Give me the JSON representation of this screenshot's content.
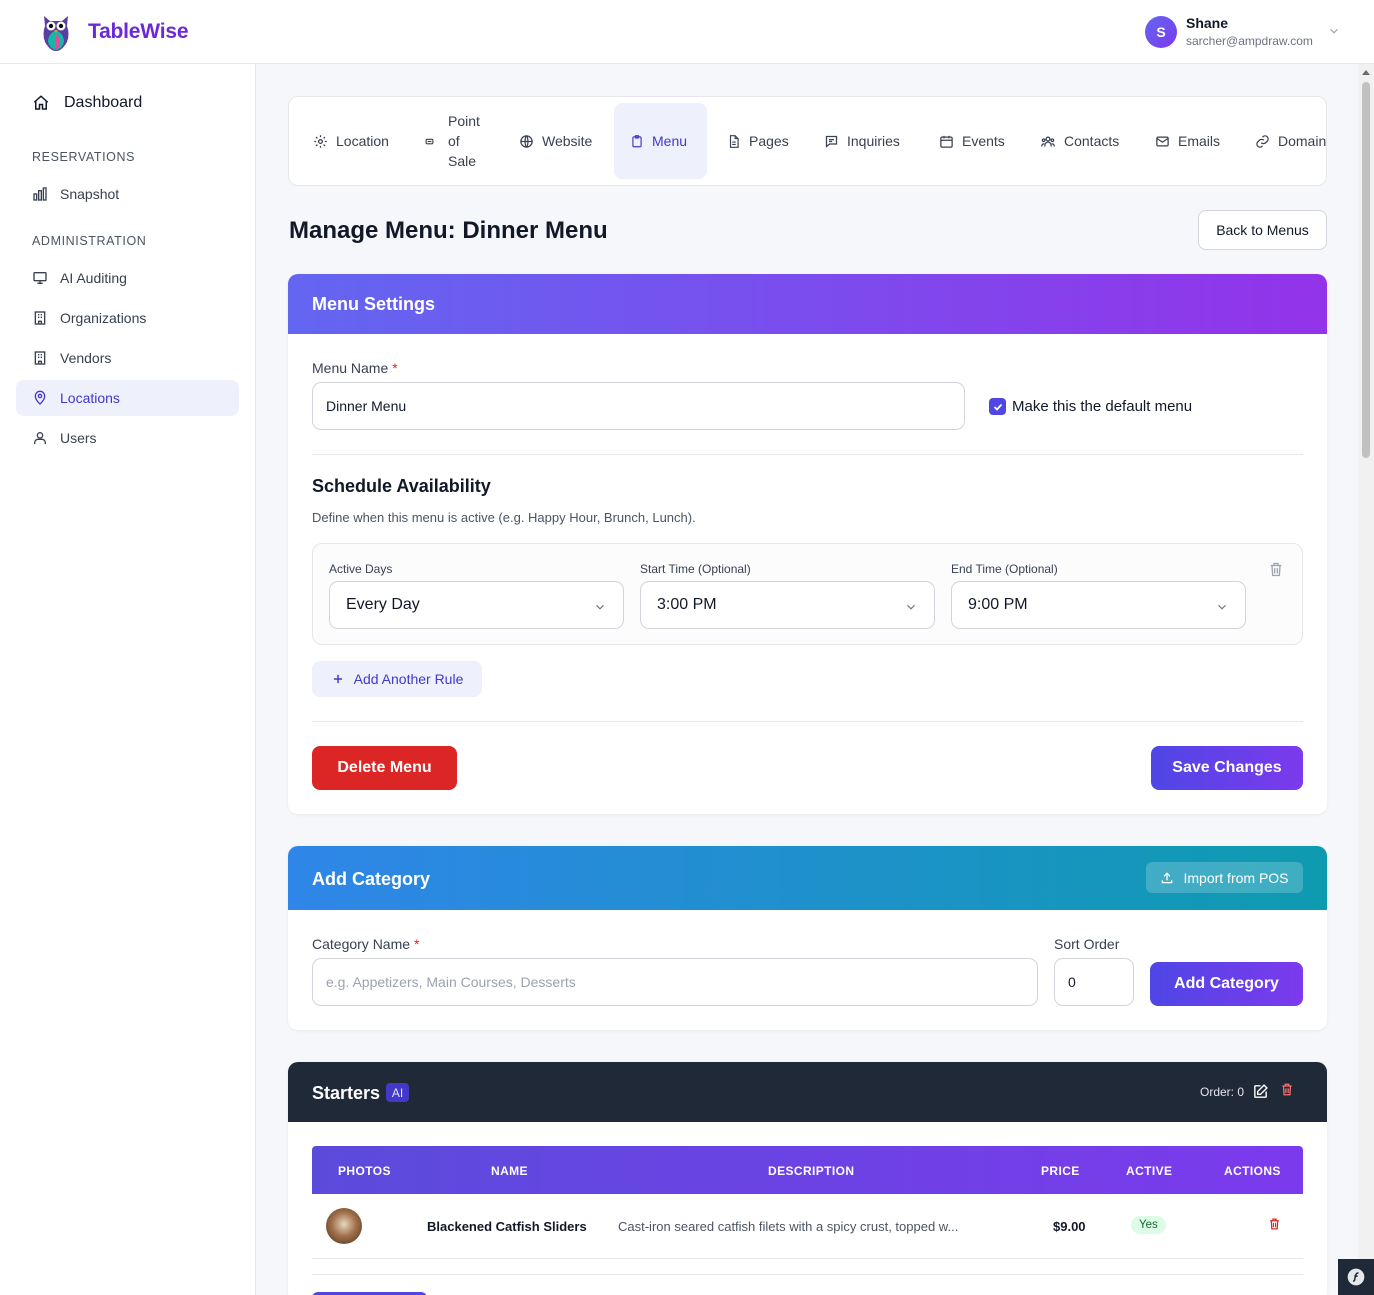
{
  "app": {
    "brand": "TableWise"
  },
  "user": {
    "initial": "S",
    "name": "Shane",
    "email": "sarcher@ampdraw.com"
  },
  "sidebar": {
    "dashboard": "Dashboard",
    "sections": [
      {
        "title": "RESERVATIONS",
        "items": [
          {
            "label": "Snapshot",
            "icon": "chart-icon"
          }
        ]
      },
      {
        "title": "ADMINISTRATION",
        "items": [
          {
            "label": "AI Auditing",
            "icon": "monitor-icon"
          },
          {
            "label": "Organizations",
            "icon": "building-icon"
          },
          {
            "label": "Vendors",
            "icon": "building-icon"
          },
          {
            "label": "Locations",
            "icon": "map-pin-icon",
            "active": true
          },
          {
            "label": "Users",
            "icon": "users-icon"
          }
        ]
      }
    ]
  },
  "tabs": [
    {
      "label": "Location",
      "icon": "gear-icon"
    },
    {
      "label": "Point of Sale",
      "lines": [
        "Point",
        "of",
        "Sale"
      ],
      "icon": "pos-icon"
    },
    {
      "label": "Website",
      "icon": "globe-icon"
    },
    {
      "label": "Menu",
      "icon": "clipboard-icon",
      "active": true
    },
    {
      "label": "Pages",
      "icon": "document-icon"
    },
    {
      "label": "Inquiries",
      "icon": "chat-icon"
    },
    {
      "label": "Events",
      "icon": "calendar-icon"
    },
    {
      "label": "Contacts",
      "icon": "contacts-icon"
    },
    {
      "label": "Emails",
      "icon": "mail-icon"
    },
    {
      "label": "Domain",
      "icon": "link-icon"
    }
  ],
  "page": {
    "title": "Manage Menu: Dinner Menu",
    "back_button": "Back to Menus"
  },
  "menu_settings": {
    "title": "Menu Settings",
    "name_label": "Menu Name",
    "required_mark": "*",
    "name_value": "Dinner Menu",
    "default_checkbox_label": "Make this the default menu",
    "default_checked": true,
    "schedule_title": "Schedule Availability",
    "schedule_description": "Define when this menu is active (e.g. Happy Hour, Brunch, Lunch).",
    "rule": {
      "days_label": "Active Days",
      "days_value": "Every Day",
      "start_label": "Start Time (Optional)",
      "start_value": "3:00 PM",
      "end_label": "End Time (Optional)",
      "end_value": "9:00 PM"
    },
    "add_rule_button": "Add Another Rule",
    "delete_button": "Delete Menu",
    "save_button": "Save Changes"
  },
  "add_category": {
    "title": "Add Category",
    "import_button": "Import from POS",
    "name_label": "Category Name",
    "required_mark": "*",
    "name_placeholder": "e.g. Appetizers, Main Courses, Desserts",
    "sort_label": "Sort Order",
    "sort_value": "0",
    "submit_button": "Add Category"
  },
  "category": {
    "name": "Starters",
    "ai_badge": "AI",
    "order_text": "Order: 0",
    "columns": [
      "PHOTOS",
      "NAME",
      "DESCRIPTION",
      "PRICE",
      "ACTIVE",
      "ACTIONS"
    ],
    "items": [
      {
        "name": "Blackened Catfish Sliders",
        "description": "Cast-iron seared catfish filets with a spicy crust, topped w...",
        "price": "$9.00",
        "active": "Yes"
      }
    ]
  },
  "colors": {
    "accent": "#4f46e5",
    "purple": "#7c3aed",
    "danger": "#dc2626",
    "dark_header": "#1f2937",
    "blue_header": "#2f86e8",
    "teal_header": "#0e9bb0"
  }
}
